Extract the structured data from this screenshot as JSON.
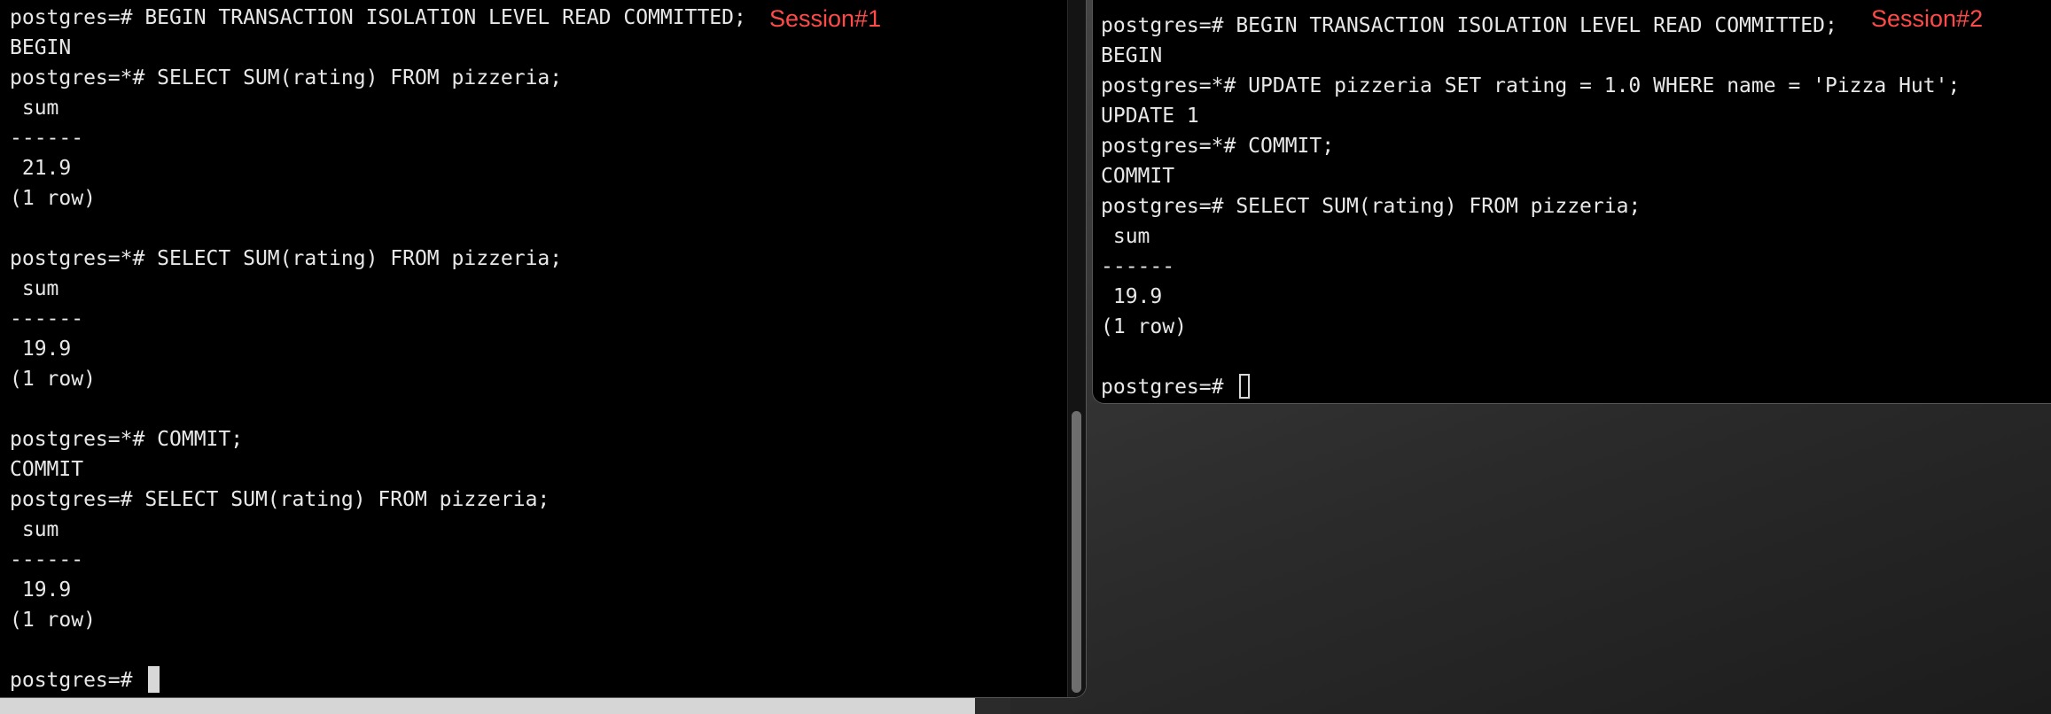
{
  "windows": [
    {
      "id": "session-1",
      "label": "Session#1",
      "label_color": "#ff4a4a",
      "lines": [
        "postgres=# BEGIN TRANSACTION ISOLATION LEVEL READ COMMITTED;",
        "BEGIN",
        "postgres=*# SELECT SUM(rating) FROM pizzeria;",
        " sum",
        "------",
        " 21.9",
        "(1 row)",
        "",
        "postgres=*# SELECT SUM(rating) FROM pizzeria;",
        " sum",
        "------",
        " 19.9",
        "(1 row)",
        "",
        "postgres=*# COMMIT;",
        "COMMIT",
        "postgres=# SELECT SUM(rating) FROM pizzeria;",
        " sum",
        "------",
        " 19.9",
        "(1 row)",
        "",
        "postgres=# "
      ],
      "cursor_style": "block"
    },
    {
      "id": "session-2",
      "label": "Session#2",
      "label_color": "#ff4a4a",
      "lines": [
        "postgres=# BEGIN TRANSACTION ISOLATION LEVEL READ COMMITTED;",
        "BEGIN",
        "postgres=*# UPDATE pizzeria SET rating = 1.0 WHERE name = 'Pizza Hut';",
        "UPDATE 1",
        "postgres=*# COMMIT;",
        "COMMIT",
        "postgres=# SELECT SUM(rating) FROM pizzeria;",
        " sum",
        "------",
        " 19.9",
        "(1 row)",
        "",
        "postgres=# "
      ],
      "cursor_style": "hollow"
    }
  ],
  "colors": {
    "terminal_background": "#000000",
    "terminal_text": "#e8e8e8",
    "session_label": "#ff4a4a",
    "scrollbar_thumb": "#6e6e6e"
  }
}
